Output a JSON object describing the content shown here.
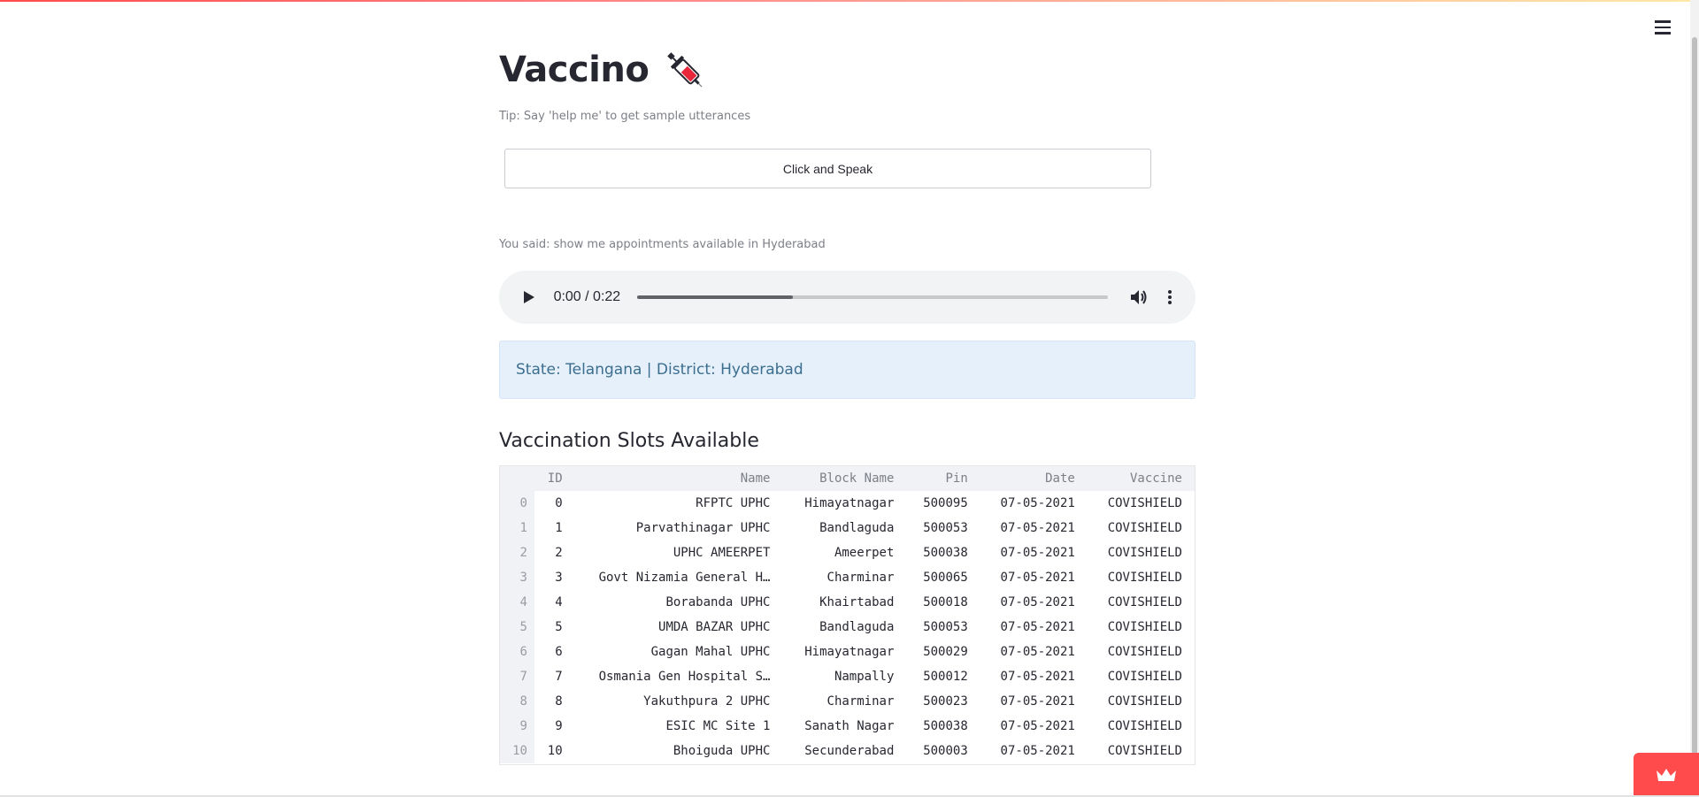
{
  "app": {
    "title": "Vaccino",
    "tip": "Tip: Say 'help me' to get sample utterances",
    "speak_button": "Click and Speak",
    "you_said": "You said: show me appointments available in Hyderabad"
  },
  "audio": {
    "time_display": "0:00 / 0:22",
    "progress_fraction": 0.33
  },
  "info": {
    "message": "State: Telangana | District: Hyderabad"
  },
  "slots": {
    "heading": "Vaccination Slots Available",
    "columns": [
      "",
      "ID",
      "Name",
      "Block Name",
      "Pin",
      "Date",
      "Vaccine"
    ],
    "rows": [
      [
        "0",
        "0",
        "RFPTC UPHC",
        "Himayatnagar",
        "500095",
        "07-05-2021",
        "COVISHIELD"
      ],
      [
        "1",
        "1",
        "Parvathinagar UPHC",
        "Bandlaguda",
        "500053",
        "07-05-2021",
        "COVISHIELD"
      ],
      [
        "2",
        "2",
        "UPHC AMEERPET",
        "Ameerpet",
        "500038",
        "07-05-2021",
        "COVISHIELD"
      ],
      [
        "3",
        "3",
        "Govt Nizamia General H…",
        "Charminar",
        "500065",
        "07-05-2021",
        "COVISHIELD"
      ],
      [
        "4",
        "4",
        "Borabanda UPHC",
        "Khairtabad",
        "500018",
        "07-05-2021",
        "COVISHIELD"
      ],
      [
        "5",
        "5",
        "UMDA BAZAR UPHC",
        "Bandlaguda",
        "500053",
        "07-05-2021",
        "COVISHIELD"
      ],
      [
        "6",
        "6",
        "Gagan Mahal UPHC",
        "Himayatnagar",
        "500029",
        "07-05-2021",
        "COVISHIELD"
      ],
      [
        "7",
        "7",
        "Osmania Gen Hospital S…",
        "Nampally",
        "500012",
        "07-05-2021",
        "COVISHIELD"
      ],
      [
        "8",
        "8",
        "Yakuthpura 2 UPHC",
        "Charminar",
        "500023",
        "07-05-2021",
        "COVISHIELD"
      ],
      [
        "9",
        "9",
        "ESIC MC Site 1",
        "Sanath Nagar",
        "500038",
        "07-05-2021",
        "COVISHIELD"
      ],
      [
        "10",
        "10",
        "Bhoiguda UPHC",
        "Secunderabad",
        "500003",
        "07-05-2021",
        "COVISHIELD"
      ]
    ]
  },
  "icons": {
    "menu": "hamburger-menu-icon",
    "title_emoji": "syringe-icon",
    "play": "play-icon",
    "volume": "volume-icon",
    "more": "more-vertical-icon",
    "brand": "crown-icon"
  },
  "colors": {
    "accent": "#ff4b4b",
    "info_bg": "#e6f0fa",
    "info_text": "#3c6e8f"
  }
}
